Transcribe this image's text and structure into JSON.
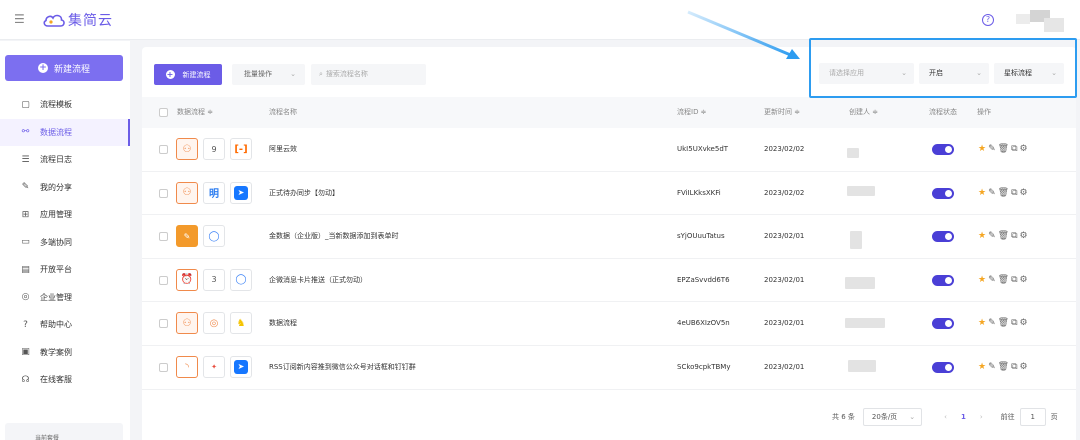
{
  "header": {
    "brand": "集简云",
    "help_icon": "question-circle-icon",
    "menu_icon": "menu-toggle-icon"
  },
  "sidebar": {
    "new_button": "新建流程",
    "items": [
      {
        "label": "流程模板",
        "icon": "template-icon",
        "glyph": "▢"
      },
      {
        "label": "数据流程",
        "icon": "flow-icon",
        "glyph": "⚯",
        "active": true
      },
      {
        "label": "流程日志",
        "icon": "log-icon",
        "glyph": "☰"
      },
      {
        "label": "我的分享",
        "icon": "share-icon",
        "glyph": "✎"
      },
      {
        "label": "应用管理",
        "icon": "apps-icon",
        "glyph": "⊞"
      },
      {
        "label": "多端协同",
        "icon": "multi-device-icon",
        "glyph": "▭"
      },
      {
        "label": "开放平台",
        "icon": "open-platform-icon",
        "glyph": "▤"
      },
      {
        "label": "企业管理",
        "icon": "enterprise-icon",
        "glyph": "◎"
      },
      {
        "label": "帮助中心",
        "icon": "help-center-icon",
        "glyph": "?"
      },
      {
        "label": "教学案例",
        "icon": "case-icon",
        "glyph": "▣"
      },
      {
        "label": "在线客服",
        "icon": "support-icon",
        "glyph": "☊"
      }
    ],
    "footer": "当前套餐"
  },
  "toolbar": {
    "new_button": "新建流程",
    "batch": "批量操作",
    "search_placeholder": "搜索流程名称",
    "filter_app_placeholder": "请选择应用",
    "filter_status": "开启",
    "filter_star": "星标流程"
  },
  "table": {
    "headers": {
      "flow": "数据流程 ≑",
      "name": "流程名称",
      "id": "流程ID ≑",
      "updated": "更新时间 ≑",
      "creator": "创建人 ≑",
      "status": "流程状态",
      "ops": "操作"
    },
    "rows": [
      {
        "name": "阿里云效",
        "id": "UkI5UXvke5dT",
        "updated": "2023/02/02",
        "enabled": true
      },
      {
        "name": "正式待办同步【勿动】",
        "id": "FViILKksXKFi",
        "updated": "2023/02/02",
        "enabled": true
      },
      {
        "name": "金数据（企业版）_当新数据添加到表单时",
        "id": "sYjOUuuTatus",
        "updated": "2023/02/01",
        "enabled": true
      },
      {
        "name": "企微消息卡片推送（正式勿动）",
        "id": "EPZaSvvdd6T6",
        "updated": "2023/02/01",
        "enabled": true
      },
      {
        "name": "数据流程",
        "id": "4eUB6XIzOV5n",
        "updated": "2023/02/01",
        "enabled": true
      },
      {
        "name": "RSS订阅新内容推到微信公众号对话框和钉钉群",
        "id": "SCko9cpkTBMy",
        "updated": "2023/02/01",
        "enabled": true
      }
    ],
    "row_icons": {
      "r0_num": "9",
      "r1_text": "明",
      "r3_num": "3"
    }
  },
  "pagination": {
    "total": "共 6 条",
    "page_size": "20条/页",
    "current": "1",
    "goto_label": "前往",
    "goto_value": "1",
    "page_unit": "页"
  },
  "colors": {
    "accent": "#6b5ce7",
    "highlight": "#2d9cf0"
  }
}
